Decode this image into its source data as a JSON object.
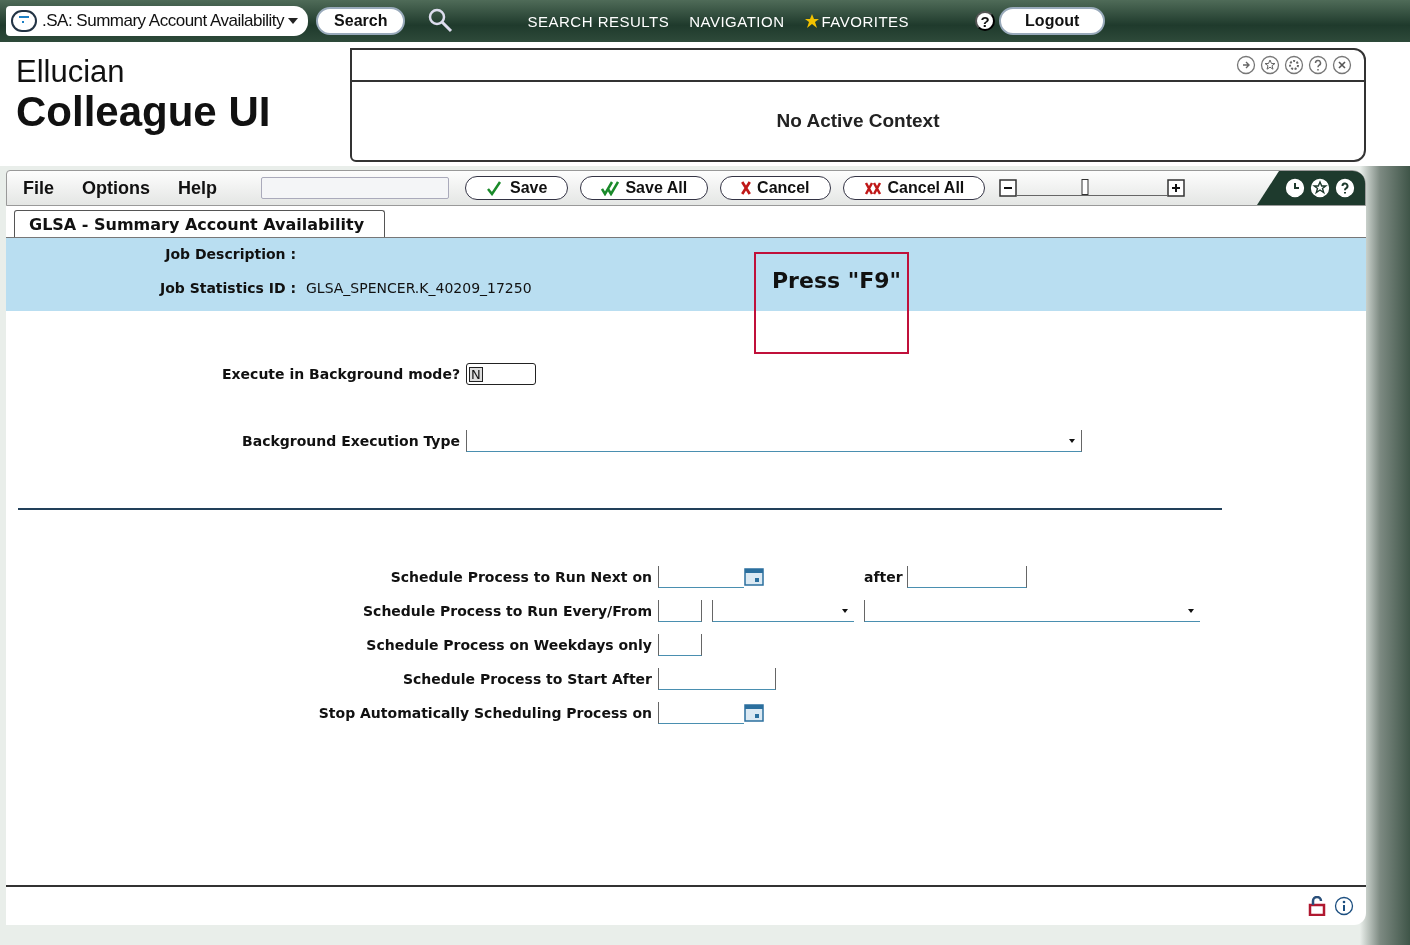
{
  "top_bar": {
    "form_selector": ".SA: Summary Account Availability",
    "search_button": "Search",
    "nav_links": [
      {
        "label": "SEARCH RESULTS",
        "kind": "plain"
      },
      {
        "label": "NAVIGATION",
        "kind": "plain"
      },
      {
        "label": "FAVORITES",
        "kind": "star"
      }
    ],
    "help": "?",
    "logout": "Logout"
  },
  "brand": {
    "line1": "Ellucian",
    "line2": "Colleague UI"
  },
  "context_panel": {
    "message": "No Active Context"
  },
  "menu": [
    "File",
    "Options",
    "Help"
  ],
  "toolbar_buttons": [
    {
      "label": "Save",
      "kind": "check"
    },
    {
      "label": "Save All",
      "kind": "double-check"
    },
    {
      "label": "Cancel",
      "kind": "cross"
    },
    {
      "label": "Cancel All",
      "kind": "double-cross"
    }
  ],
  "zoom_slider": {
    "level": 0.45
  },
  "form_tab": {
    "label": "GLSA - Summary Account Availability",
    "selected": true
  },
  "job": {
    "description_label": "Job Description :",
    "statistics_label": "Job Statistics ID :",
    "statistics_id": "GLSA_SPENCER.K_40209_17250"
  },
  "callout": "Press \"F9\"",
  "execute_background": {
    "label": "Execute in Background mode?",
    "value": "N"
  },
  "execution_type": {
    "label": "Background Execution Type"
  },
  "schedule": [
    {
      "label": "Schedule Process to Run Next on",
      "controls": [
        {
          "kind": "date"
        },
        {
          "kind": "labeled-text",
          "label": "after"
        }
      ]
    },
    {
      "label": "Schedule Process to Run Every/From",
      "controls": [
        {
          "kind": "short"
        },
        {
          "kind": "select"
        },
        {
          "kind": "wide-select"
        }
      ]
    },
    {
      "label": "Schedule Process on Weekdays only",
      "controls": [
        {
          "kind": "short"
        }
      ]
    },
    {
      "label": "Schedule Process to Start After",
      "controls": [
        {
          "kind": "medium"
        }
      ]
    },
    {
      "label": "Stop Automatically Scheduling Process on",
      "controls": [
        {
          "kind": "date"
        }
      ]
    }
  ]
}
